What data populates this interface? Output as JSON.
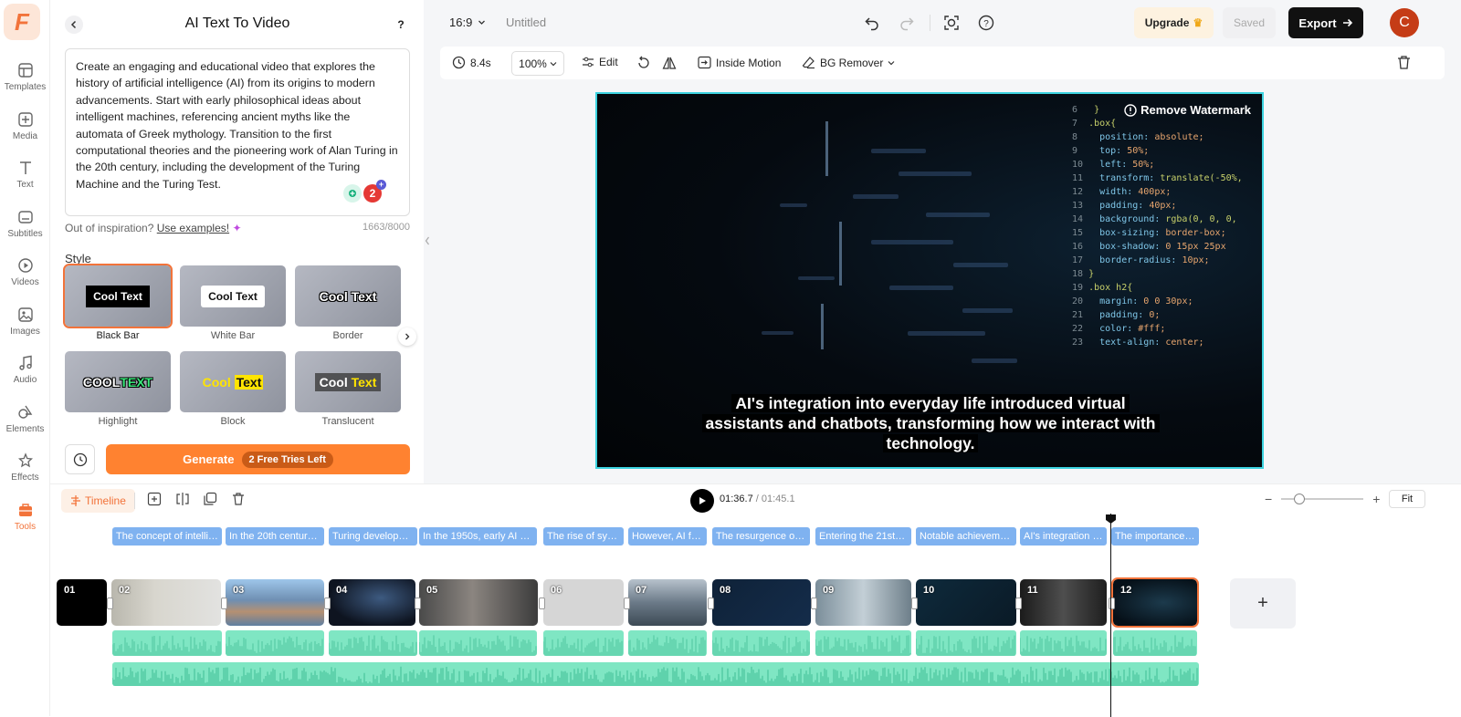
{
  "logo_letter": "F",
  "rail": [
    {
      "label": "Templates",
      "icon": "templates-icon"
    },
    {
      "label": "Media",
      "icon": "media-icon"
    },
    {
      "label": "Text",
      "icon": "text-icon"
    },
    {
      "label": "Subtitles",
      "icon": "subtitles-icon"
    },
    {
      "label": "Videos",
      "icon": "videos-icon"
    },
    {
      "label": "Images",
      "icon": "images-icon"
    },
    {
      "label": "Audio",
      "icon": "audio-icon"
    },
    {
      "label": "Elements",
      "icon": "elements-icon"
    },
    {
      "label": "Effects",
      "icon": "effects-icon"
    },
    {
      "label": "Tools",
      "icon": "tools-icon",
      "active": true
    }
  ],
  "panel": {
    "title": "AI Text To Video",
    "help": "?",
    "prompt": "Create an engaging and educational video that explores the history of artificial intelligence (AI) from its origins to modern advancements. Start with early philosophical ideas about intelligent machines, referencing ancient myths like the automata of Greek mythology. Transition to the first computational theories and the pioneering work of Alan Turing in the 20th century, including the development of the Turing Machine and the Turing Test.",
    "badge_count": "2",
    "inspiration_text": "Out of inspiration?",
    "inspiration_link": "Use examples!",
    "counter": "1663/8000",
    "style_label": "Style",
    "styles": [
      {
        "name": "Black Bar",
        "sample": "Cool Text",
        "selected": true
      },
      {
        "name": "White Bar",
        "sample": "Cool Text"
      },
      {
        "name": "Border",
        "sample": "Cool Text"
      },
      {
        "name": "Highlight",
        "sample_a": "COOL",
        "sample_b": "TEXT"
      },
      {
        "name": "Block",
        "sample_a": "Cool",
        "sample_b": "Text"
      },
      {
        "name": "Translucent",
        "sample_a": "Cool",
        "sample_b": "Text"
      }
    ],
    "generate_label": "Generate",
    "tries_label": "2 Free Tries Left"
  },
  "topbar": {
    "aspect": "16:9",
    "project_name": "Untitled",
    "upgrade": "Upgrade",
    "saved": "Saved",
    "export": "Export",
    "avatar_letter": "C"
  },
  "toolbar": {
    "duration": "8.4s",
    "zoom": "100%",
    "edit": "Edit",
    "inside_motion": "Inside Motion",
    "bg_remover": "BG Remover"
  },
  "canvas": {
    "watermark": "Remove Watermark",
    "subtitle_lines": [
      "AI's integration into everyday life introduced virtual",
      "assistants and chatbots, transforming how we interact with",
      "technology."
    ]
  },
  "timeline": {
    "label": "Timeline",
    "current_time": "01:36.7",
    "total_time": "/ 01:45.1",
    "fit": "Fit",
    "subtitles": [
      "The concept of intellig...",
      "In the 20th century, ...",
      "Turing developed...",
      "In the 1950s, early AI pro...",
      "The rise of sym...",
      "However, AI fac...",
      "The resurgence of A...",
      "Entering the 21st c...",
      "Notable achievemen...",
      "AI's integration in...",
      "The importance o..."
    ],
    "clips": [
      "01",
      "02",
      "03",
      "04",
      "05",
      "06",
      "07",
      "08",
      "09",
      "10",
      "11",
      "12"
    ],
    "add_clip": "+"
  }
}
